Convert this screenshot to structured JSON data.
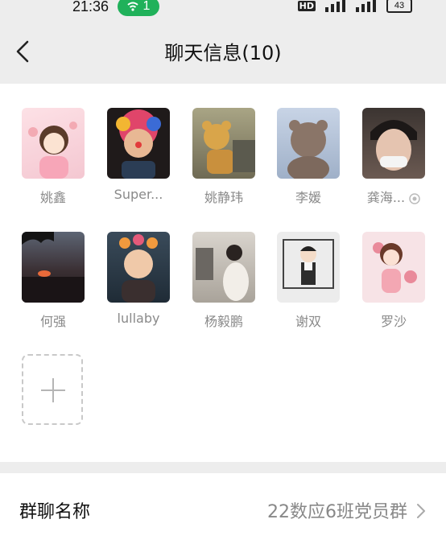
{
  "status_bar": {
    "time": "21:36",
    "hotspot_count": "1",
    "hd_label": "HD",
    "battery": "43"
  },
  "header": {
    "title": "聊天信息(10)"
  },
  "members": [
    {
      "name": "姚鑫",
      "avatar": "cartoon-girl-avatar"
    },
    {
      "name": "Super...",
      "avatar": "clown-face-avatar"
    },
    {
      "name": "姚静玮",
      "avatar": "winnie-bear-avatar"
    },
    {
      "name": "李媛",
      "avatar": "teddy-bear-avatar"
    },
    {
      "name": "龚海...",
      "avatar": "boy-photo-avatar"
    },
    {
      "name": "何强",
      "avatar": "sunset-avatar"
    },
    {
      "name": "lullaby",
      "avatar": "flower-girl-avatar"
    },
    {
      "name": "杨毅鹏",
      "avatar": "girl-photo-avatar"
    },
    {
      "name": "谢双",
      "avatar": "cartoon-boy-avatar"
    },
    {
      "name": "罗沙",
      "avatar": "cartoon-girl-pink-avatar"
    }
  ],
  "group_name_row": {
    "label": "群聊名称",
    "value": "22数应6班党员群"
  }
}
